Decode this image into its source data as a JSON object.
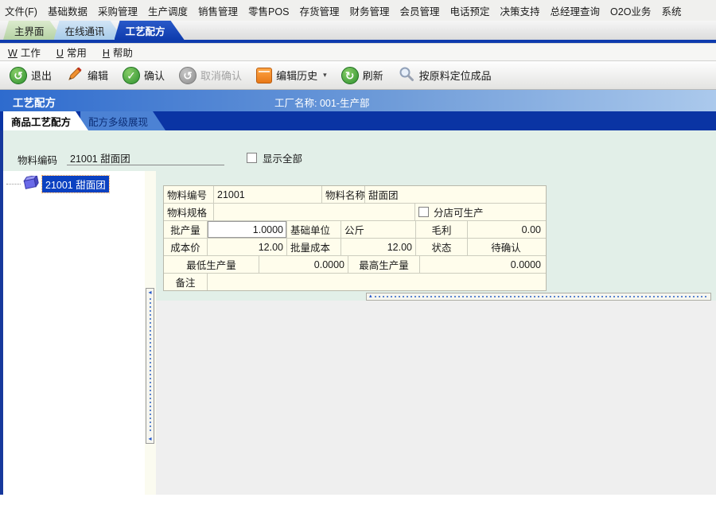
{
  "menu_top": {
    "items": [
      "文件(F)",
      "基础数据",
      "采购管理",
      "生产调度",
      "销售管理",
      "零售POS",
      "存货管理",
      "财务管理",
      "会员管理",
      "电话预定",
      "决策支持",
      "总经理查询",
      "O2O业务",
      "系统"
    ]
  },
  "window_tabs": {
    "main": "主界面",
    "online": "在线通讯",
    "recipe": "工艺配方"
  },
  "menu_second": {
    "work_key": "W",
    "work": "工作",
    "common_key": "U",
    "common": "常用",
    "help_key": "H",
    "help": "帮助"
  },
  "toolbar": {
    "exit": "退出",
    "edit": "编辑",
    "confirm": "确认",
    "cancel_confirm": "取消确认",
    "edit_history": "编辑历史",
    "refresh": "刷新",
    "locate": "按原料定位成品"
  },
  "icons": {
    "exit": "↺",
    "confirm": "✓",
    "cancel": "↺",
    "refresh": "↻",
    "dropdown": "▾",
    "v_arrow": "◂",
    "h_arrow": "▴"
  },
  "title_bar": {
    "title": "工艺配方",
    "factory": "工厂名称: 001-生产部"
  },
  "sub_tabs": {
    "product_recipe": "商品工艺配方",
    "multilevel": "配方多级展现"
  },
  "form": {
    "material_code_label": "物料编码",
    "material_code_value": "21001 甜面团",
    "show_all_label": "显示全部"
  },
  "tree": {
    "node": "21001 甜面团"
  },
  "fields": {
    "material_no_label": "物料编号",
    "material_no": "21001",
    "material_name_label": "物料名称",
    "material_name": "甜面团",
    "spec_label": "物料规格",
    "spec": "",
    "branch_producible_label": "分店可生产",
    "batch_qty_label": "批产量",
    "batch_qty": "1.0000",
    "base_unit_label": "基础单位",
    "base_unit": "公斤",
    "gross_profit_label": "毛利",
    "gross_profit": "0.00",
    "cost_price_label": "成本价",
    "cost_price": "12.00",
    "batch_cost_label": "批量成本",
    "batch_cost": "12.00",
    "status_label": "状态",
    "status": "待确认",
    "min_qty_label": "最低生产量",
    "min_qty": "0.0000",
    "max_qty_label": "最高生产量",
    "max_qty": "0.0000",
    "remark_label": "备注",
    "remark": ""
  },
  "colors": {
    "accent_blue": "#0e3bad",
    "title_gradient_left": "#2e6bce",
    "content_green": "#e2efe8",
    "cell_cream": "#fffdec",
    "selection_blue": "#0b41c1",
    "toolbar_green": "#2f9230",
    "history_orange": "#e87817"
  }
}
